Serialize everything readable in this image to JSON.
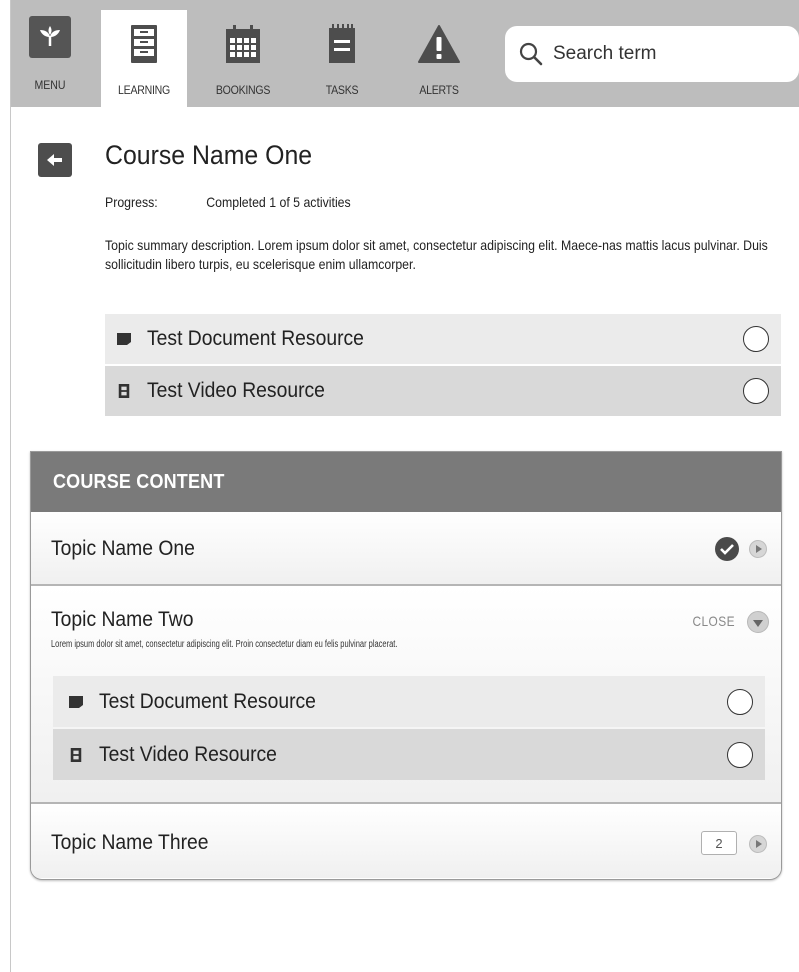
{
  "nav": {
    "menu_label": "MENU",
    "tabs": [
      {
        "label": "LEARNING",
        "icon": "cabinet-icon",
        "active": true
      },
      {
        "label": "BOOKINGS",
        "icon": "calendar-icon",
        "active": false
      },
      {
        "label": "TASKS",
        "icon": "notepad-icon",
        "active": false
      },
      {
        "label": "ALERTS",
        "icon": "warning-icon",
        "active": false
      }
    ],
    "search": {
      "placeholder": "Search term"
    }
  },
  "course": {
    "title": "Course Name One",
    "progress_label": "Progress:",
    "progress_value": "Completed 1 of 5 activities",
    "summary": "Topic summary description. Lorem ipsum dolor sit amet, consectetur adipiscing elit. Maece-nas mattis lacus pulvinar. Duis sollicitudin libero turpis, eu scelerisque enim ullamcorper.",
    "resources": [
      {
        "label": "Test Document Resource",
        "icon": "document-icon"
      },
      {
        "label": "Test Video Resource",
        "icon": "video-icon"
      }
    ]
  },
  "content": {
    "header": "COURSE CONTENT",
    "topics": [
      {
        "title": "Topic Name One",
        "status": "completed"
      },
      {
        "title": "Topic Name Two",
        "description": "Lorem ipsum dolor sit amet, consectetur adipiscing elit. Proin consectetur diam eu felis pulvinar placerat.",
        "close_label": "CLOSE",
        "resources": [
          {
            "label": "Test Document Resource",
            "icon": "document-icon"
          },
          {
            "label": "Test Video Resource",
            "icon": "video-icon"
          }
        ]
      },
      {
        "title": "Topic Name Three",
        "count": "2"
      }
    ]
  },
  "colors": {
    "topbar": "#bdbdbd",
    "panel_header": "#7a7a7a",
    "dark_icon": "#4d4d4d"
  }
}
